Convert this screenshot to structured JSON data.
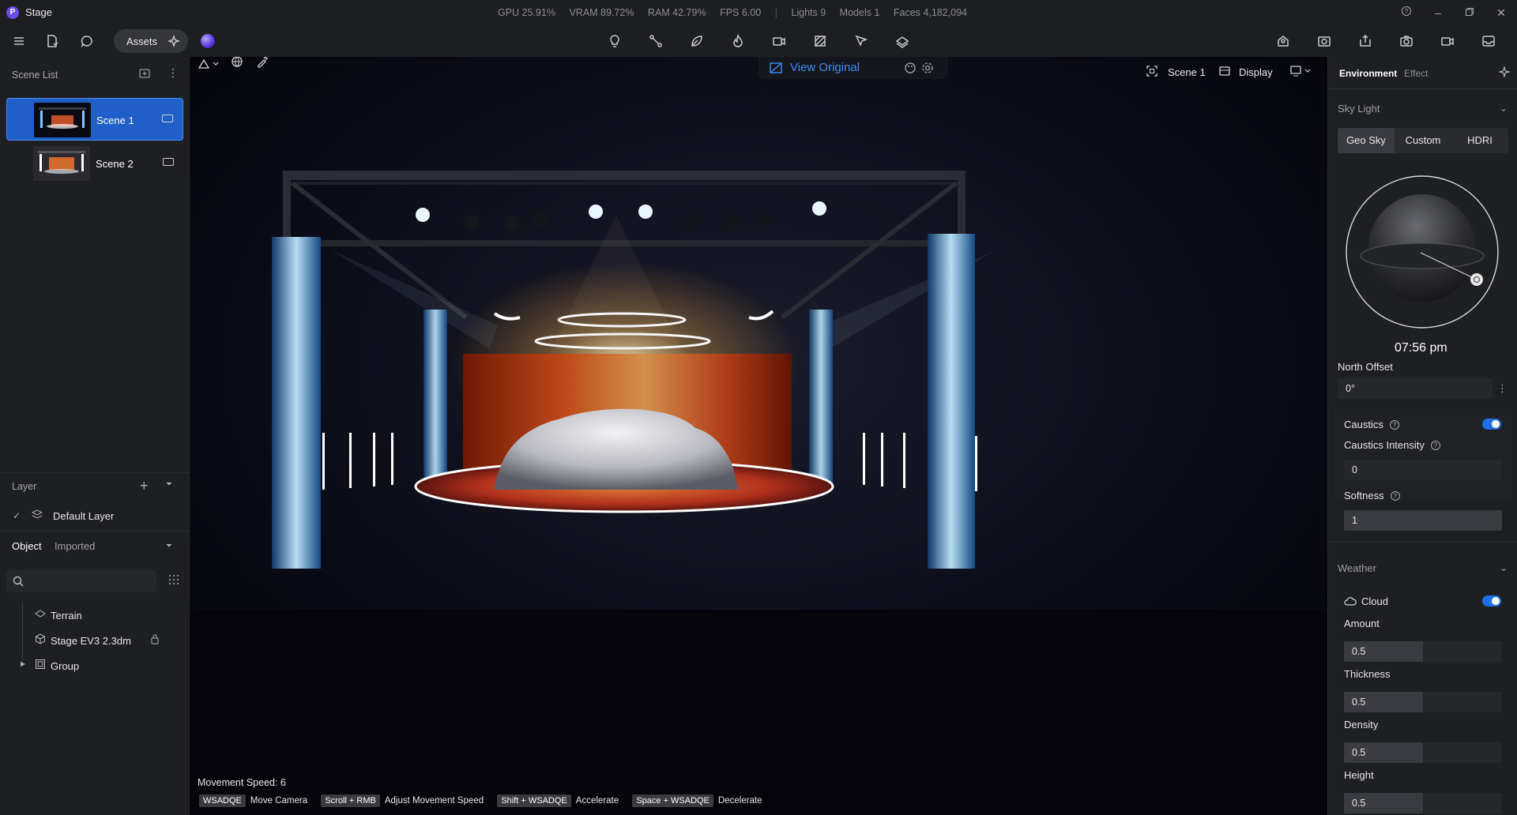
{
  "app": {
    "title": "Stage",
    "logo_letter": "P"
  },
  "stats": {
    "gpu": "GPU 25.91%",
    "vram": "VRAM 89.72%",
    "ram": "RAM 42.79%",
    "fps": "FPS 6.00",
    "separator": "|",
    "lights": "Lights 9",
    "models": "Models 1",
    "faces": "Faces 4,182,094"
  },
  "toolbar": {
    "assets_label": "Assets"
  },
  "scene_list": {
    "title": "Scene List",
    "items": [
      {
        "name": "Scene 1",
        "active": true
      },
      {
        "name": "Scene 2",
        "active": false
      }
    ]
  },
  "layer": {
    "title": "Layer",
    "default_layer": "Default Layer"
  },
  "object": {
    "tab_object": "Object",
    "tab_imported": "Imported",
    "items": [
      {
        "name": "Terrain",
        "icon": "terrain-icon"
      },
      {
        "name": "Stage EV3 2.3dm",
        "icon": "cube-icon"
      },
      {
        "name": "Group",
        "icon": "group-icon"
      }
    ]
  },
  "viewport": {
    "view_original": "View Original",
    "scene_label": "Scene 1",
    "display_label": "Display",
    "movement_speed": "Movement Speed: 6",
    "hints": [
      {
        "key": "WSADQE",
        "action": "Move Camera"
      },
      {
        "key": "Scroll + RMB",
        "action": "Adjust Movement Speed"
      },
      {
        "key": "Shift + WSADQE",
        "action": "Accelerate"
      },
      {
        "key": "Space + WSADQE",
        "action": "Decelerate"
      }
    ]
  },
  "environment": {
    "tab_environment": "Environment",
    "tab_effect": "Effect",
    "sky_light_title": "Sky Light",
    "sky_tabs": [
      "Geo Sky",
      "Custom",
      "HDRI"
    ],
    "active_sky_tab": "Geo Sky",
    "time": "07:56 pm",
    "north_offset_label": "North Offset",
    "north_offset_value": "0°",
    "caustics_label": "Caustics",
    "caustics_enabled": true,
    "caustics_intensity_label": "Caustics Intensity",
    "caustics_intensity_value": "0",
    "softness_label": "Softness",
    "softness_value": "1",
    "weather_title": "Weather",
    "cloud_label": "Cloud",
    "cloud_enabled": true,
    "amount_label": "Amount",
    "amount_value": "0.5",
    "thickness_label": "Thickness",
    "thickness_value": "0.5",
    "density_label": "Density",
    "density_value": "0.5",
    "height_label": "Height",
    "height_value": "0.5"
  },
  "colors": {
    "accent": "#1e6fe8",
    "selection": "#1f5fc7",
    "link": "#3f8cf5",
    "panel_bg": "#1e1f22"
  }
}
